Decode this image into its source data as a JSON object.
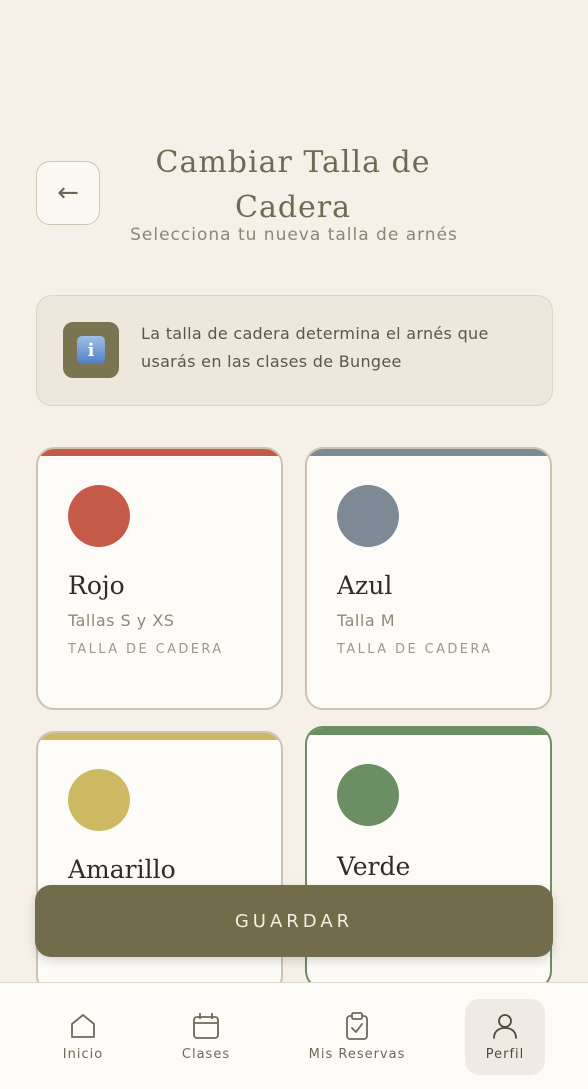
{
  "header": {
    "back_icon": "arrow-left-icon",
    "title": "Cambiar Talla de Cadera",
    "subtitle": "Selecciona tu nueva talla de arnés"
  },
  "info": {
    "icon": "info-icon",
    "text": "La talla de cadera determina el arnés que usarás en las clases de Bungee"
  },
  "sizes": [
    {
      "name": "Rojo",
      "sizes": "Tallas S y XS",
      "caption": "TALLA DE CADERA",
      "color": "#c65a48",
      "selected": false
    },
    {
      "name": "Azul",
      "sizes": "Talla M",
      "caption": "TALLA DE CADERA",
      "color": "#7d8a96",
      "selected": false
    },
    {
      "name": "Amarillo",
      "sizes": "",
      "caption": "",
      "color": "#cdb962",
      "selected": false
    },
    {
      "name": "Verde",
      "sizes": "",
      "caption": "",
      "color": "#6b8e62",
      "selected": true
    }
  ],
  "save_label": "GUARDAR",
  "nav": [
    {
      "label": "Inicio",
      "icon": "home-icon",
      "active": false
    },
    {
      "label": "Clases",
      "icon": "calendar-icon",
      "active": false
    },
    {
      "label": "Mis Reservas",
      "icon": "clipboard-check-icon",
      "active": false
    },
    {
      "label": "Perfil",
      "icon": "user-icon",
      "active": true
    }
  ],
  "colors": {
    "background": "#f5f0e8",
    "accent": "#736c4a",
    "selected_border": "#6b8e62"
  }
}
